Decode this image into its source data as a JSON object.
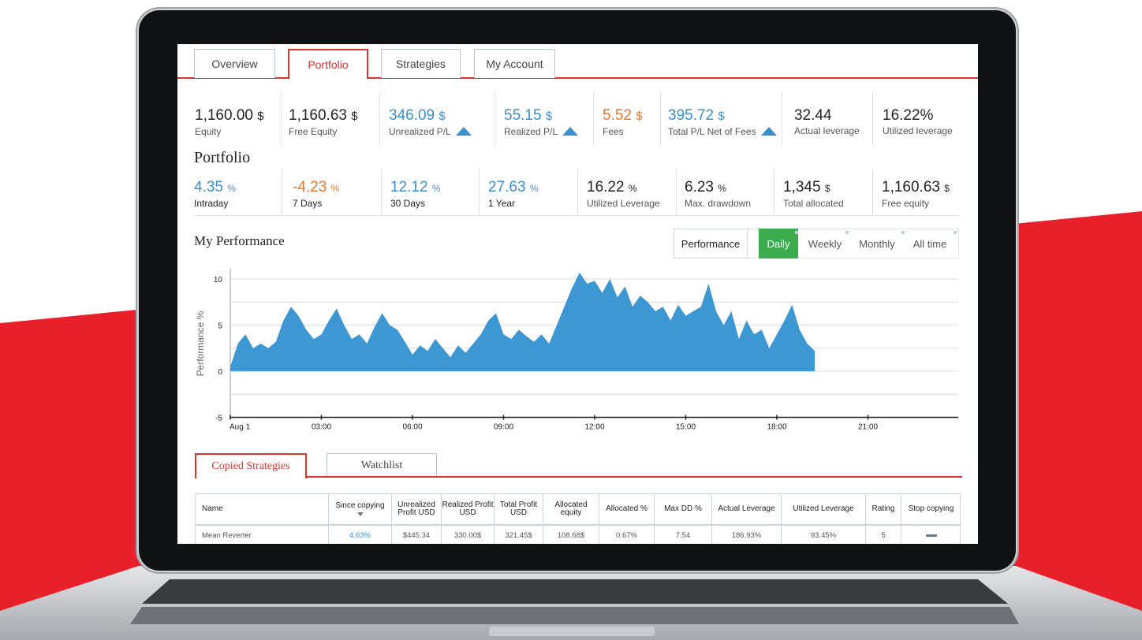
{
  "tabs": [
    "Overview",
    "Portfolio",
    "Strategies",
    "My Account"
  ],
  "summary": [
    {
      "value": "1,160.00",
      "unit": "$",
      "label": "Equity",
      "color": "dark"
    },
    {
      "value": "1,160.63",
      "unit": "$",
      "label": "Free Equity",
      "color": "dark"
    },
    {
      "value": "346.09",
      "unit": "$",
      "label": "Unrealized P/L",
      "color": "blue",
      "icon": "triangle-up-icon"
    },
    {
      "value": "55.15",
      "unit": "$",
      "label": "Realized P/L",
      "color": "blue",
      "icon": "triangle-up-icon"
    },
    {
      "value": "5.52",
      "unit": "$",
      "label": "Fees",
      "color": "orange"
    },
    {
      "value": "395.72",
      "unit": "$",
      "label": "Total P/L Net of Fees",
      "color": "blue",
      "icon": "triangle-up-icon"
    },
    {
      "value": "32.44",
      "unit": "",
      "label": "Actual leverage",
      "color": "dark"
    },
    {
      "value": "16.22%",
      "unit": "",
      "label": "Utilized leverage",
      "color": "dark"
    }
  ],
  "portfolio": {
    "title": "Portfolio",
    "stats": [
      {
        "value": "4.35",
        "unit": "%",
        "label": "Intraday",
        "color": "blue"
      },
      {
        "value": "-4.23",
        "unit": "%",
        "label": "7 Days",
        "color": "orange"
      },
      {
        "value": "12.12",
        "unit": "%",
        "label": "30 Days",
        "color": "blue"
      },
      {
        "value": "27.63",
        "unit": "%",
        "label": "1 Year",
        "color": "blue"
      },
      {
        "value": "16.22",
        "unit": "%",
        "label": "Utilized Leverage",
        "color": "dark"
      },
      {
        "value": "6.23",
        "unit": "%",
        "label": "Max. drawdown",
        "color": "dark"
      },
      {
        "value": "1,345",
        "unit": "$",
        "label": "Total allocated",
        "color": "dark"
      },
      {
        "value": "1,160.63",
        "unit": "$",
        "label": "Free equity",
        "color": "dark"
      }
    ]
  },
  "performance": {
    "title": "My Performance",
    "toggles": [
      "Performance",
      "Daily",
      "Weekly",
      "Monthly",
      "All time"
    ],
    "active_toggle": "Daily"
  },
  "chart_data": {
    "type": "area",
    "title": "",
    "xlabel": "",
    "ylabel": "Performance %",
    "xticks": [
      "Aug 1",
      "03:00",
      "06:00",
      "09:00",
      "12:00",
      "15:00",
      "18:00",
      "21:00"
    ],
    "yticks": [
      10,
      5,
      0,
      -5
    ],
    "ylim": [
      -5,
      11
    ],
    "xlim_hours": [
      0,
      24
    ],
    "grid": true,
    "fill_color": "#3d97d3",
    "x_hours": [
      0,
      0.25,
      0.5,
      0.75,
      1,
      1.25,
      1.5,
      1.75,
      2,
      2.25,
      2.5,
      2.75,
      3,
      3.25,
      3.5,
      3.75,
      4,
      4.25,
      4.5,
      4.75,
      5,
      5.25,
      5.5,
      5.75,
      6,
      6.25,
      6.5,
      6.75,
      7,
      7.25,
      7.5,
      7.75,
      8,
      8.25,
      8.5,
      8.75,
      9,
      9.25,
      9.5,
      9.75,
      10,
      10.25,
      10.5,
      10.75,
      11,
      11.25,
      11.5,
      11.75,
      12,
      12.25,
      12.5,
      12.75,
      13,
      13.25,
      13.5,
      13.75,
      14,
      14.25,
      14.5,
      14.75,
      15,
      15.25,
      15.5,
      15.75,
      16,
      16.25,
      16.5,
      16.75,
      17,
      17.25,
      17.5,
      17.75,
      18,
      18.25,
      18.5,
      18.75,
      19,
      19.25
    ],
    "values": [
      0.5,
      3,
      4,
      2.5,
      3,
      2.5,
      3.2,
      5.5,
      7,
      6,
      4.5,
      3.5,
      4,
      5.5,
      6.8,
      5,
      3.5,
      4,
      3,
      4.8,
      6.3,
      5,
      4.5,
      3.2,
      1.8,
      2.8,
      2.2,
      3.5,
      2.5,
      1.5,
      2.8,
      2,
      3,
      4,
      5.5,
      6.3,
      4,
      3.5,
      4.5,
      3.8,
      3.2,
      4,
      3,
      5,
      7,
      9,
      10.7,
      9.5,
      9.8,
      8.5,
      10,
      8,
      9.2,
      7,
      8.2,
      7.5,
      6.5,
      7,
      5.5,
      7.2,
      6,
      6.5,
      7,
      9.5,
      6.5,
      5,
      6.5,
      3.5,
      5.5,
      4,
      4.5,
      2.5,
      4,
      5.5,
      7.2,
      4.5,
      3,
      2.2
    ]
  },
  "bottom_tabs": [
    "Copied Strategies",
    "Watchlist"
  ],
  "table": {
    "columns": [
      "Name",
      "Since copying",
      "Unrealized Profit USD",
      "Realized Profit USD",
      "Total Profit USD",
      "Allocated equity",
      "Allocated %",
      "Max DD %",
      "Actual Leverage",
      "Utilized Leverage",
      "Rating",
      "Stop copying"
    ],
    "rows": [
      [
        "Mean Reverter",
        "4.63%",
        "$445.34",
        "330.00$",
        "321.45$",
        "108.68$",
        "0.67%",
        "7.54",
        "186.93%",
        "93.45%",
        "5",
        ""
      ]
    ]
  },
  "colors": {
    "accent_red": "#d9332f",
    "blue": "#3a8fcd",
    "orange": "#e8762c",
    "green": "#3bad4f",
    "bg_red": "#e8202a"
  }
}
